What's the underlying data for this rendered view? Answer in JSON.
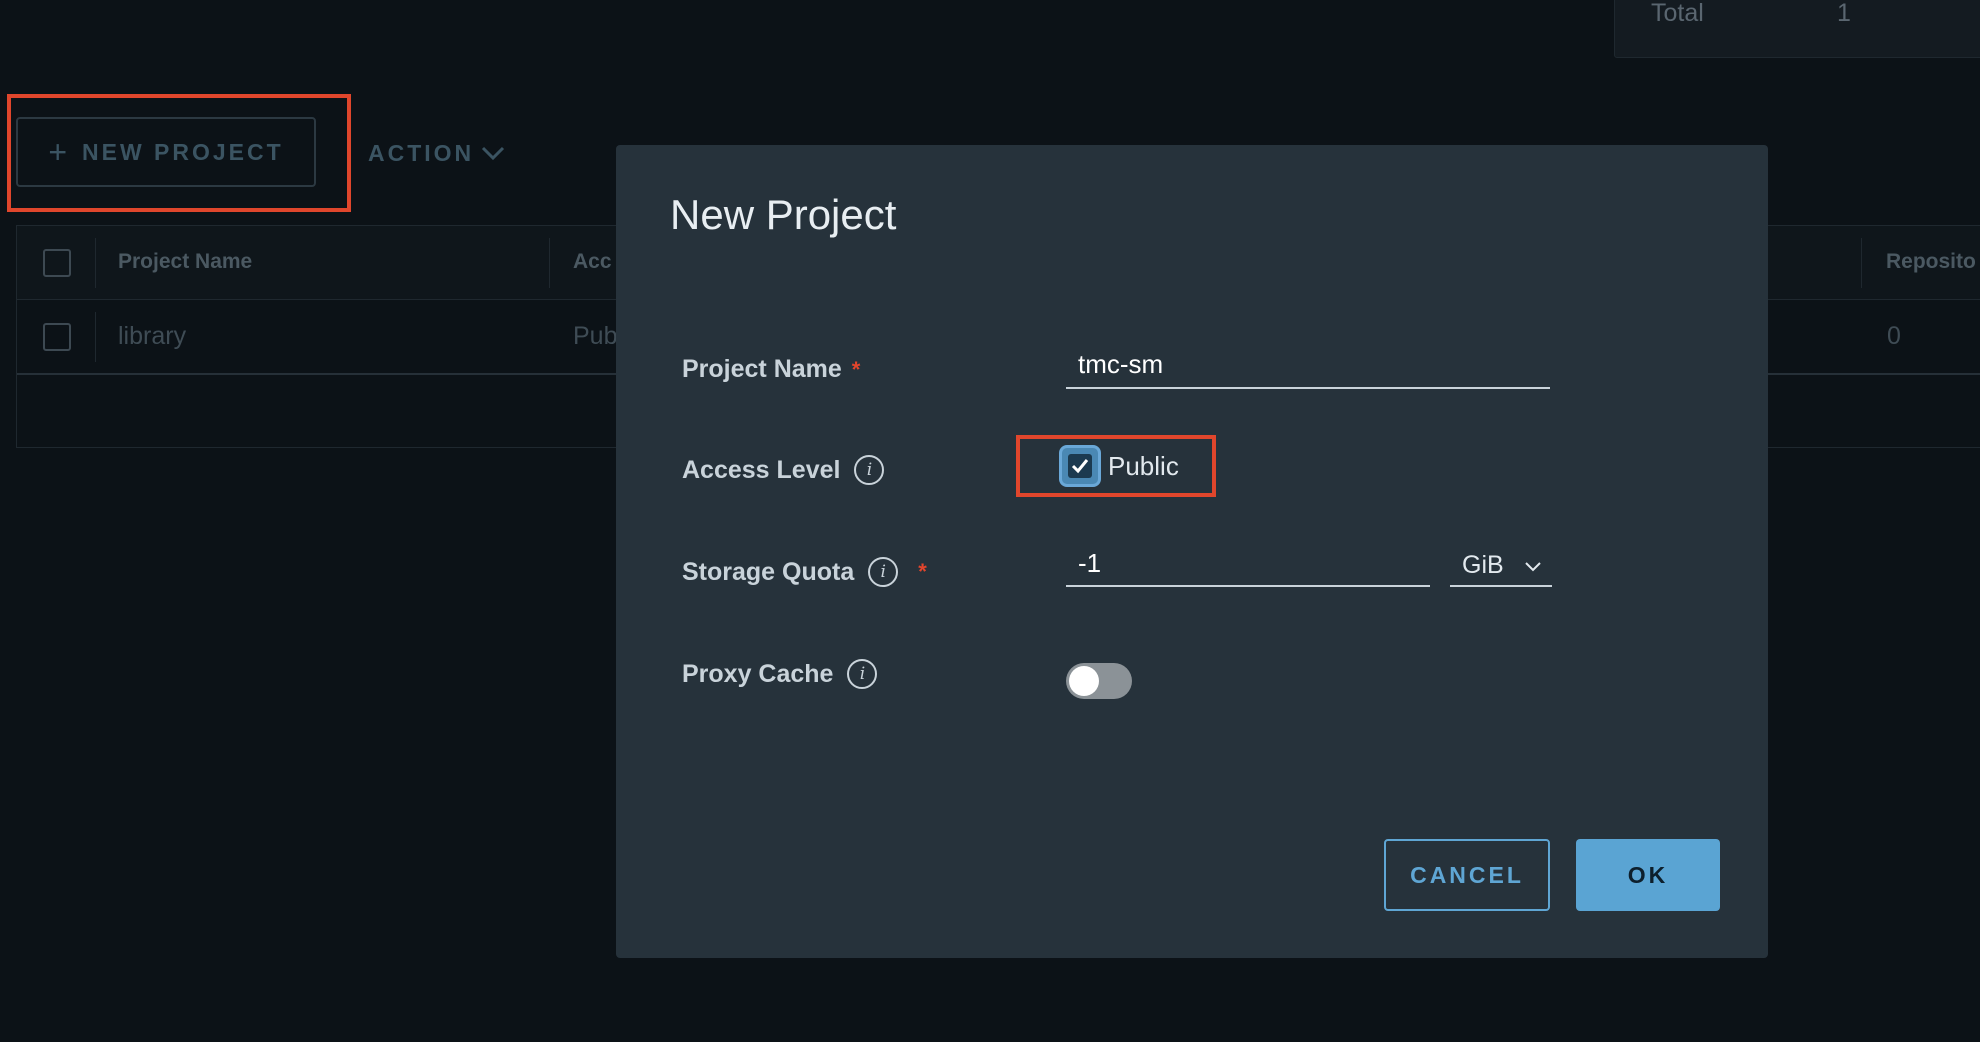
{
  "summary": {
    "label": "Total",
    "value": "1"
  },
  "toolbar": {
    "new_project_label": "NEW PROJECT",
    "action_label": "ACTION"
  },
  "table": {
    "columns": [
      "Project Name",
      "Acc",
      "Reposito"
    ],
    "rows": [
      {
        "name": "library",
        "access": "Pub",
        "repos": "0"
      }
    ]
  },
  "modal": {
    "title": "New Project",
    "project_name_label": "Project Name",
    "project_name_value": "tmc-sm",
    "access_level_label": "Access Level",
    "public_label": "Public",
    "public_checked": true,
    "storage_quota_label": "Storage Quota",
    "storage_quota_value": "-1",
    "storage_unit": "GiB",
    "proxy_cache_label": "Proxy Cache",
    "proxy_cache_enabled": false,
    "required_mark": "*",
    "info_glyph": "i",
    "cancel_label": "CANCEL",
    "ok_label": "OK"
  },
  "colors": {
    "highlight": "#e0462c",
    "accent": "#5aa4d3",
    "modal_bg": "#26323b"
  }
}
